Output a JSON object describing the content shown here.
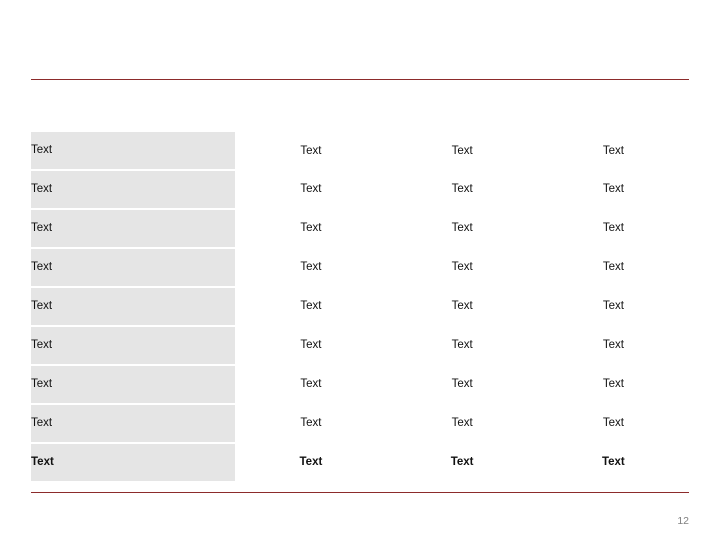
{
  "slide": {
    "page_number": "12",
    "accent_color": "#8c2b2b",
    "row_fill_color": "#e5e5e5",
    "table": {
      "rows": [
        {
          "label": "Text",
          "values": [
            "Text",
            "Text",
            "Text"
          ],
          "bold": false
        },
        {
          "label": "Text",
          "values": [
            "Text",
            "Text",
            "Text"
          ],
          "bold": false
        },
        {
          "label": "Text",
          "values": [
            "Text",
            "Text",
            "Text"
          ],
          "bold": false
        },
        {
          "label": "Text",
          "values": [
            "Text",
            "Text",
            "Text"
          ],
          "bold": false
        },
        {
          "label": "Text",
          "values": [
            "Text",
            "Text",
            "Text"
          ],
          "bold": false
        },
        {
          "label": "Text",
          "values": [
            "Text",
            "Text",
            "Text"
          ],
          "bold": false
        },
        {
          "label": "Text",
          "values": [
            "Text",
            "Text",
            "Text"
          ],
          "bold": false
        },
        {
          "label": "Text",
          "values": [
            "Text",
            "Text",
            "Text"
          ],
          "bold": false
        },
        {
          "label": "Text",
          "values": [
            "Text",
            "Text",
            "Text"
          ],
          "bold": true
        }
      ]
    }
  }
}
